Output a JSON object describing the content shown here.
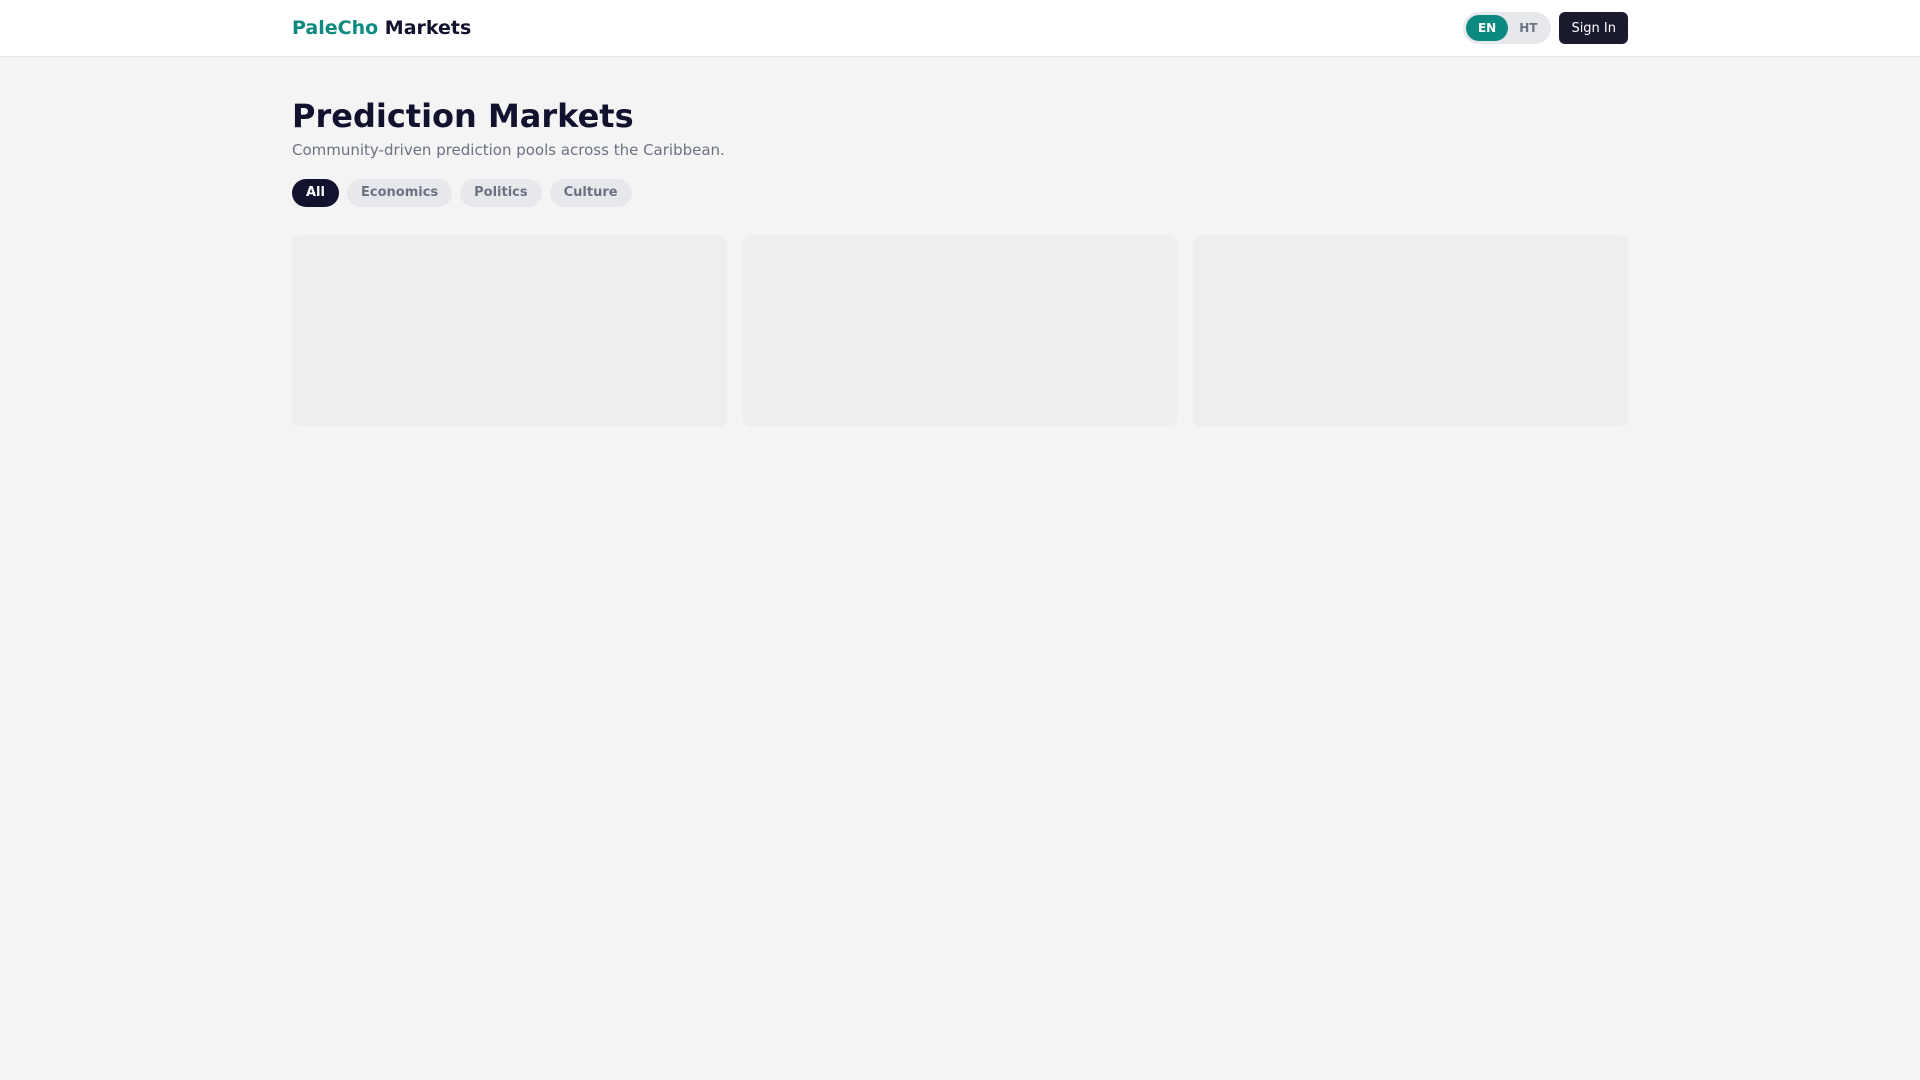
{
  "header": {
    "brand_accent": "PaleCho",
    "brand_rest": "Markets",
    "lang": [
      "EN",
      "HT"
    ],
    "active_lang": "EN",
    "sign_in": "Sign In"
  },
  "main": {
    "title": "Prediction Markets",
    "subtitle": "Community-driven prediction pools across the Caribbean.",
    "filters": [
      "All",
      "Economics",
      "Politics",
      "Culture"
    ],
    "active_filter": "All"
  },
  "colors": {
    "accent": "#0d8a80",
    "dark": "#12122e"
  }
}
